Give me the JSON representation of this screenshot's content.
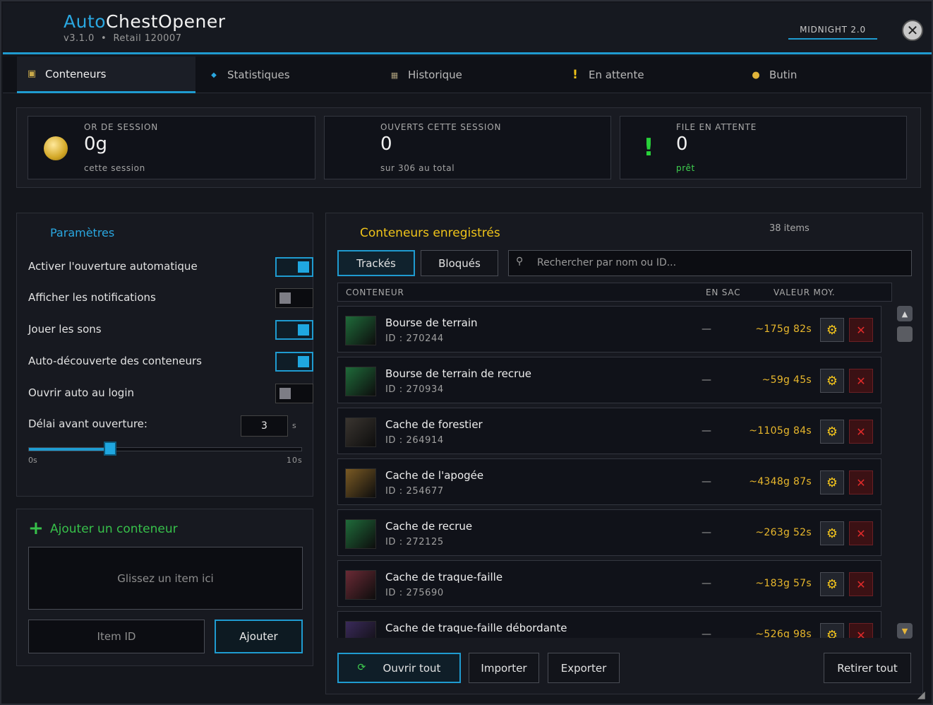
{
  "app": {
    "title_accent": "Auto",
    "title_rest": "ChestOpener",
    "subtitle": "v3.1.0  •  Retail 120007",
    "badge": "MIDNIGHT 2.0",
    "close_glyph": "✕"
  },
  "tabs": [
    {
      "label": "Conteneurs",
      "icon": "chest-icon",
      "glyph": "▣"
    },
    {
      "label": "Statistiques",
      "icon": "diamond-icon",
      "glyph": "◆"
    },
    {
      "label": "Historique",
      "icon": "scroll-icon",
      "glyph": "▦"
    },
    {
      "label": "En attente",
      "icon": "exclamation-icon",
      "glyph": "!"
    },
    {
      "label": "Butin",
      "icon": "coins-icon",
      "glyph": "●"
    }
  ],
  "stats": {
    "gold": {
      "label": "OR DE SESSION",
      "value": "0g",
      "sub": "cette session"
    },
    "opened": {
      "label": "OUVERTS CETTE SESSION",
      "value": "0",
      "sub": "sur 306 au total"
    },
    "queue": {
      "label": "FILE EN ATTENTE",
      "value": "0",
      "sub": "prêt"
    }
  },
  "settings": {
    "title": "Paramètres",
    "rows": [
      {
        "label": "Activer l'ouverture automatique",
        "on": true
      },
      {
        "label": "Afficher les notifications",
        "on": false
      },
      {
        "label": "Jouer les sons",
        "on": true
      },
      {
        "label": "Auto-découverte des conteneurs",
        "on": true
      },
      {
        "label": "Ouvrir auto au login",
        "on": false
      }
    ],
    "delay_label": "Délai avant ouverture:",
    "delay_value": "3",
    "delay_unit": "s",
    "slider_min": "0s",
    "slider_max": "10s",
    "slider_value": 3
  },
  "add": {
    "title": "Ajouter un conteneur",
    "dropzone": "Glissez un item ici",
    "itemid_placeholder": "Item ID",
    "add_button": "Ajouter"
  },
  "registered": {
    "title": "Conteneurs enregistrés",
    "count": "38 items",
    "tab_tracked": "Trackés",
    "tab_blocked": "Bloqués",
    "search_placeholder": "Rechercher par nom ou ID...",
    "columns": {
      "container": "CONTENEUR",
      "in_bag": "EN SAC",
      "avg_value": "VALEUR MOY."
    },
    "items": [
      {
        "name": "Bourse de terrain",
        "id": "ID : 270244",
        "in_bag": "—",
        "value": "~175g 82s",
        "color": "#1f6b3a"
      },
      {
        "name": "Bourse de terrain de recrue",
        "id": "ID : 270934",
        "in_bag": "—",
        "value": "~59g 45s",
        "color": "#1f6b3a"
      },
      {
        "name": "Cache de forestier",
        "id": "ID : 264914",
        "in_bag": "—",
        "value": "~1105g 84s",
        "color": "#3a3530"
      },
      {
        "name": "Cache de l'apogée",
        "id": "ID : 254677",
        "in_bag": "—",
        "value": "~4348g 87s",
        "color": "#7a5a24"
      },
      {
        "name": "Cache de recrue",
        "id": "ID : 272125",
        "in_bag": "—",
        "value": "~263g 52s",
        "color": "#1f6b3a"
      },
      {
        "name": "Cache de traque-faille",
        "id": "ID : 275690",
        "in_bag": "—",
        "value": "~183g 57s",
        "color": "#6a2a35"
      },
      {
        "name": "Cache de traque-faille débordante",
        "id": "",
        "in_bag": "—",
        "value": "~526g 98s",
        "color": "#3a2a5a"
      }
    ],
    "footer": {
      "open_all": "Ouvrir tout",
      "import": "Importer",
      "export": "Exporter",
      "remove_all": "Retirer tout"
    }
  },
  "colors": {
    "accent": "#1f9bd0",
    "gold": "#e8b72c",
    "green": "#37c04a",
    "danger": "#e02a2a"
  }
}
